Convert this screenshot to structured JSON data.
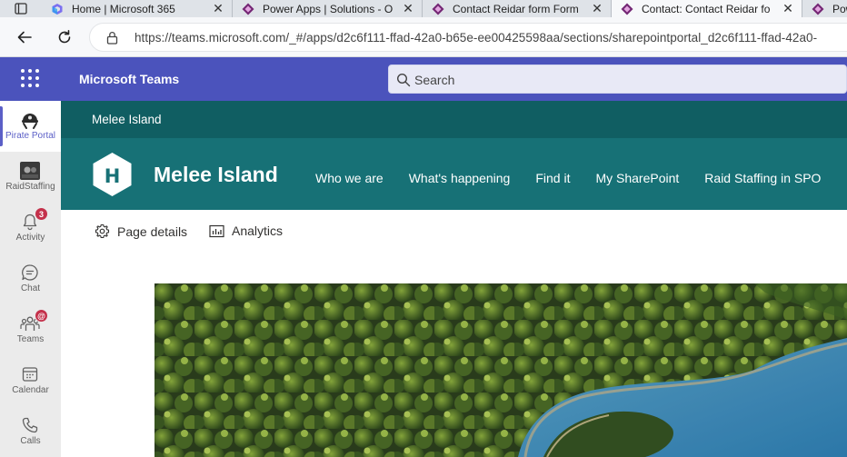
{
  "browser": {
    "tabs": [
      {
        "title": "Home | Microsoft 365",
        "favicon": "microsoft-365-icon",
        "active": false
      },
      {
        "title": "Power Apps | Solutions - O",
        "favicon": "power-apps-icon",
        "active": false
      },
      {
        "title": "Contact Reidar form Form",
        "favicon": "power-apps-icon",
        "active": false
      },
      {
        "title": "Contact: Contact Reidar fo",
        "favicon": "power-apps-icon",
        "active": true
      },
      {
        "title": "Pow",
        "favicon": "power-apps-icon",
        "active": false
      }
    ],
    "close_glyph": "✕",
    "url": "https://teams.microsoft.com/_#/apps/d2c6f111-ffad-42a0-b65e-ee00425598aa/sections/sharepointportal_d2c6f111-ffad-42a0-"
  },
  "teams": {
    "app_name": "Microsoft Teams",
    "search_placeholder": "Search",
    "rail": [
      {
        "label": "Pirate Portal",
        "icon": "pirate-portal-icon",
        "active": true
      },
      {
        "label": "RaidStaffing",
        "icon": "raidstaffing-icon",
        "active": false
      },
      {
        "label": "Activity",
        "icon": "bell-icon",
        "badge": "3"
      },
      {
        "label": "Chat",
        "icon": "chat-icon"
      },
      {
        "label": "Teams",
        "icon": "teams-icon",
        "badge": "@"
      },
      {
        "label": "Calendar",
        "icon": "calendar-icon"
      },
      {
        "label": "Calls",
        "icon": "phone-icon"
      }
    ]
  },
  "site": {
    "breadcrumb": "Melee Island",
    "logo_letter": "H",
    "title": "Melee Island",
    "nav": [
      "Who we are",
      "What's happening",
      "Find it",
      "My SharePoint",
      "Raid Staffing in SPO"
    ],
    "commands": [
      {
        "label": "Page details",
        "icon": "gear-icon"
      },
      {
        "label": "Analytics",
        "icon": "analytics-icon"
      }
    ]
  },
  "colors": {
    "teams_header": "#4b53bc",
    "sp_topbar": "#105e62",
    "sp_hub": "#177176",
    "accent": "#5b5fc7",
    "badge": "#c4314b"
  }
}
